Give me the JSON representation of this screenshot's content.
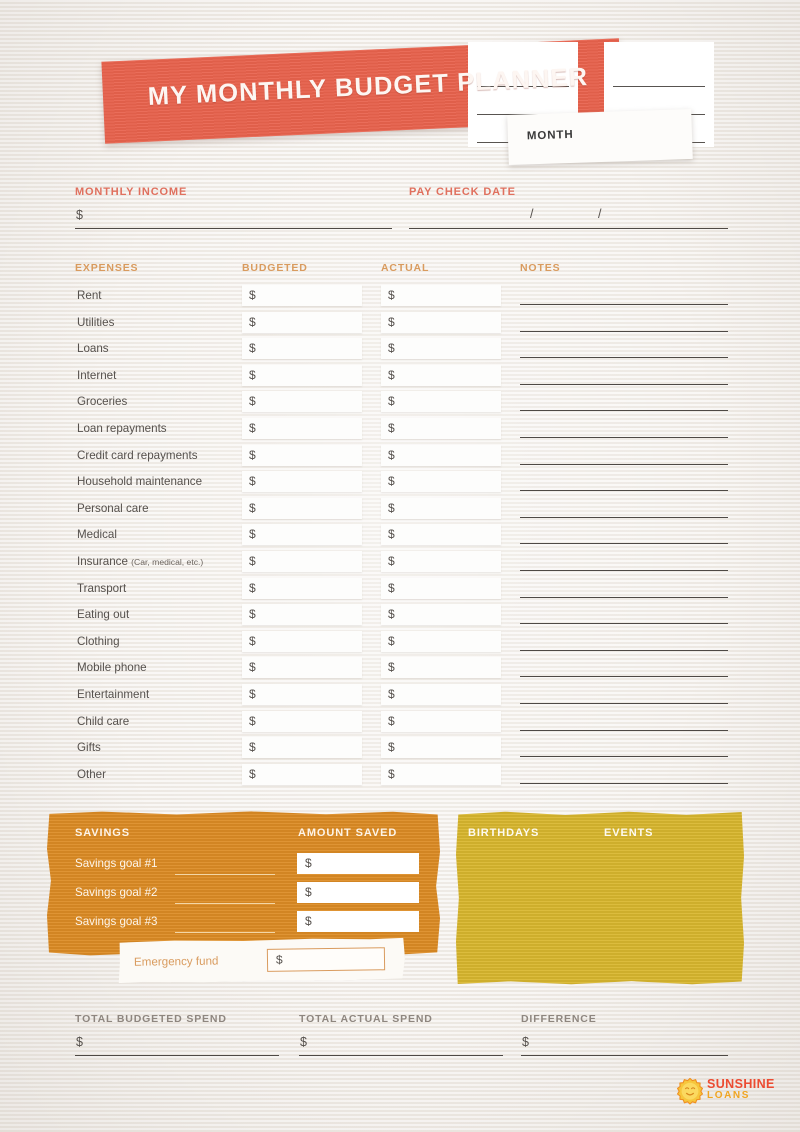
{
  "header": {
    "title": "MY MONTHLY BUDGET PLANNER",
    "month_label": "MONTH",
    "banner_color": "#e8624d"
  },
  "income": {
    "monthly_income_label": "MONTHLY INCOME",
    "monthly_income_value": "",
    "currency_symbol": "$",
    "pay_check_date_label": "PAY CHECK DATE",
    "date_separator": "/"
  },
  "expenses": {
    "column_headers": {
      "expenses": "EXPENSES",
      "budgeted": "BUDGETED",
      "actual": "ACTUAL",
      "notes": "NOTES"
    },
    "currency_symbol": "$",
    "rows": [
      {
        "label": "Rent",
        "sub": "",
        "budgeted": "",
        "actual": "",
        "note": ""
      },
      {
        "label": "Utilities",
        "sub": "",
        "budgeted": "",
        "actual": "",
        "note": ""
      },
      {
        "label": "Loans",
        "sub": "",
        "budgeted": "",
        "actual": "",
        "note": ""
      },
      {
        "label": "Internet",
        "sub": "",
        "budgeted": "",
        "actual": "",
        "note": ""
      },
      {
        "label": "Groceries",
        "sub": "",
        "budgeted": "",
        "actual": "",
        "note": ""
      },
      {
        "label": "Loan repayments",
        "sub": "",
        "budgeted": "",
        "actual": "",
        "note": ""
      },
      {
        "label": "Credit card repayments",
        "sub": "",
        "budgeted": "",
        "actual": "",
        "note": ""
      },
      {
        "label": "Household maintenance",
        "sub": "",
        "budgeted": "",
        "actual": "",
        "note": ""
      },
      {
        "label": "Personal care",
        "sub": "",
        "budgeted": "",
        "actual": "",
        "note": ""
      },
      {
        "label": "Medical",
        "sub": "",
        "budgeted": "",
        "actual": "",
        "note": ""
      },
      {
        "label": "Insurance",
        "sub": "(Car, medical, etc.)",
        "budgeted": "",
        "actual": "",
        "note": ""
      },
      {
        "label": "Transport",
        "sub": "",
        "budgeted": "",
        "actual": "",
        "note": ""
      },
      {
        "label": "Eating out",
        "sub": "",
        "budgeted": "",
        "actual": "",
        "note": ""
      },
      {
        "label": "Clothing",
        "sub": "",
        "budgeted": "",
        "actual": "",
        "note": ""
      },
      {
        "label": "Mobile phone",
        "sub": "",
        "budgeted": "",
        "actual": "",
        "note": ""
      },
      {
        "label": "Entertainment",
        "sub": "",
        "budgeted": "",
        "actual": "",
        "note": ""
      },
      {
        "label": "Child care",
        "sub": "",
        "budgeted": "",
        "actual": "",
        "note": ""
      },
      {
        "label": "Gifts",
        "sub": "",
        "budgeted": "",
        "actual": "",
        "note": ""
      },
      {
        "label": "Other",
        "sub": "",
        "budgeted": "",
        "actual": "",
        "note": ""
      }
    ]
  },
  "savings": {
    "title": "SAVINGS",
    "amount_saved_label": "AMOUNT SAVED",
    "currency_symbol": "$",
    "card_color": "#dd8c25",
    "goals": [
      {
        "label": "Savings goal #1",
        "name_value": "",
        "amount": ""
      },
      {
        "label": "Savings goal #2",
        "name_value": "",
        "amount": ""
      },
      {
        "label": "Savings goal #3",
        "name_value": "",
        "amount": ""
      }
    ],
    "emergency_fund_label": "Emergency fund",
    "emergency_fund_value": ""
  },
  "calendar": {
    "birthdays_label": "BIRTHDAYS",
    "events_label": "EVENTS",
    "card_color": "#d9b72e",
    "birthdays_lines": [
      "",
      "",
      ""
    ],
    "events_lines": [
      "",
      "",
      ""
    ]
  },
  "totals": {
    "items": [
      {
        "label": "TOTAL BUDGETED SPEND",
        "value": ""
      },
      {
        "label": "TOTAL ACTUAL SPEND",
        "value": ""
      },
      {
        "label": "DIFFERENCE",
        "value": ""
      }
    ],
    "currency_symbol": "$"
  },
  "logo": {
    "line1": "SUNSHINE",
    "line2": "LOANS",
    "line1_color": "#ec4b32",
    "line2_color": "#f0a522"
  }
}
